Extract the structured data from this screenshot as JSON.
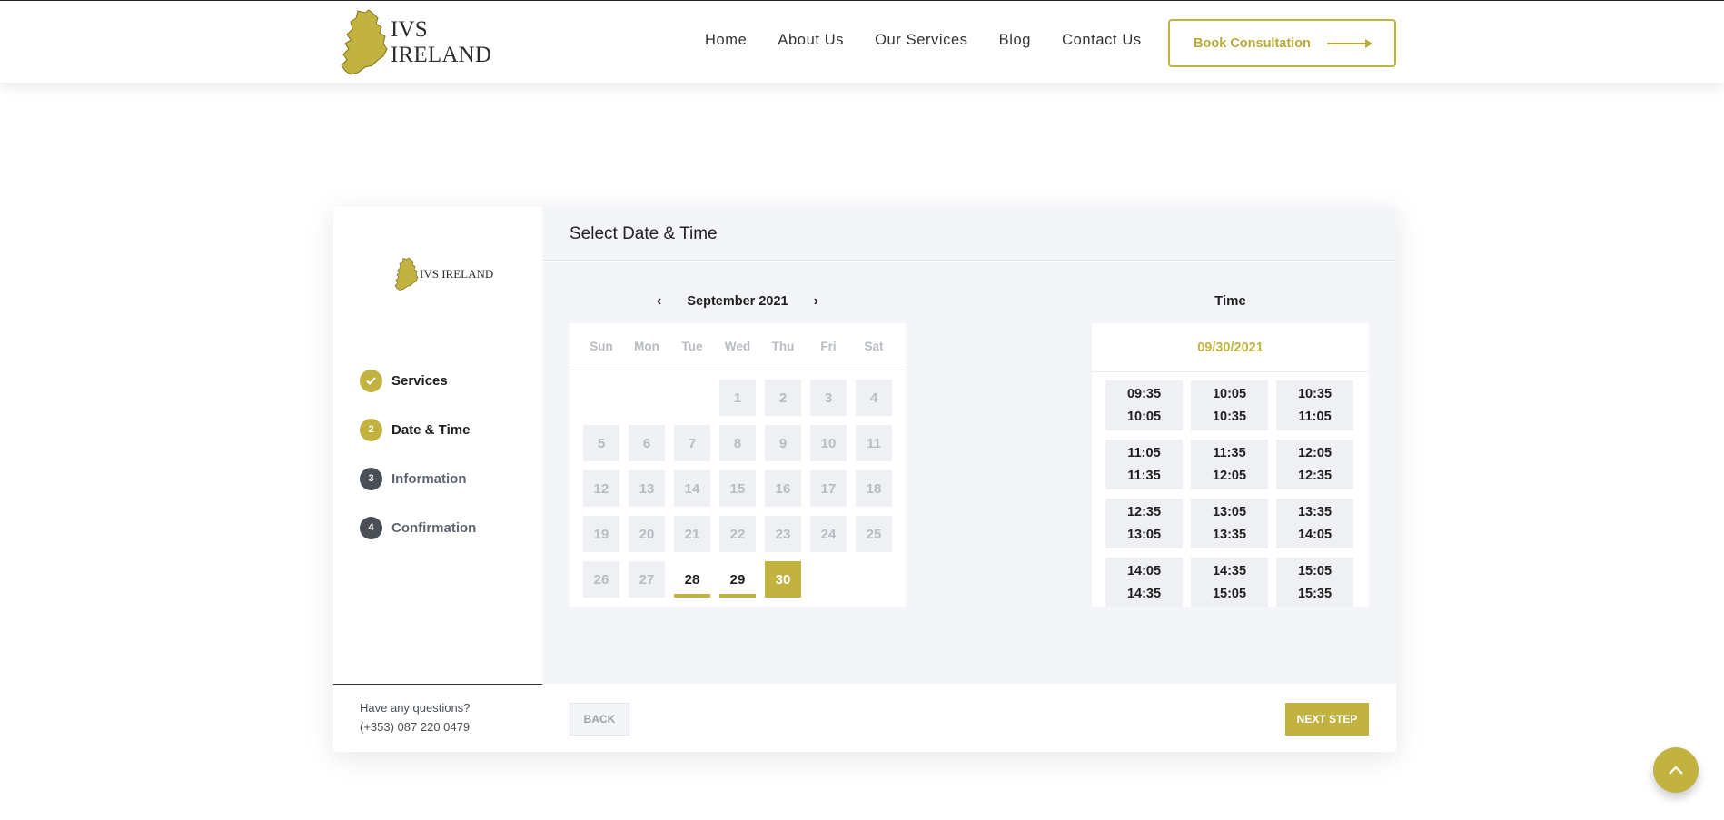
{
  "header": {
    "brand": "IVS IRELAND",
    "nav": [
      "Home",
      "About Us",
      "Our Services",
      "Blog",
      "Contact Us"
    ],
    "cta_label": "Book Consultation"
  },
  "booking": {
    "sidebar": {
      "brand": "IVS IRELAND",
      "steps": [
        {
          "number": "",
          "label": "Services",
          "status": "done"
        },
        {
          "number": "2",
          "label": "Date & Time",
          "status": "active"
        },
        {
          "number": "3",
          "label": "Information",
          "status": "pending"
        },
        {
          "number": "4",
          "label": "Confirmation",
          "status": "pending"
        }
      ],
      "questions_label": "Have any questions?",
      "phone": "(+353) 087 220 0479"
    },
    "title": "Select Date & Time",
    "calendar": {
      "month": "September 2021",
      "weekdays": [
        "Sun",
        "Mon",
        "Tue",
        "Wed",
        "Thu",
        "Fri",
        "Sat"
      ],
      "leading_blanks": 3,
      "days": [
        "1",
        "2",
        "3",
        "4",
        "5",
        "6",
        "7",
        "8",
        "9",
        "10",
        "11",
        "12",
        "13",
        "14",
        "15",
        "16",
        "17",
        "18",
        "19",
        "20",
        "21",
        "22",
        "23",
        "24",
        "25",
        "26",
        "27",
        "28",
        "29",
        "30"
      ],
      "available_days": [
        "28",
        "29"
      ],
      "selected_day": "30"
    },
    "time": {
      "title": "Time",
      "selected_date": "09/30/2021",
      "slots": [
        {
          "start": "09:35",
          "end": "10:05"
        },
        {
          "start": "10:05",
          "end": "10:35"
        },
        {
          "start": "10:35",
          "end": "11:05"
        },
        {
          "start": "11:05",
          "end": "11:35"
        },
        {
          "start": "11:35",
          "end": "12:05"
        },
        {
          "start": "12:05",
          "end": "12:35"
        },
        {
          "start": "12:35",
          "end": "13:05"
        },
        {
          "start": "13:05",
          "end": "13:35"
        },
        {
          "start": "13:35",
          "end": "14:05"
        },
        {
          "start": "14:05",
          "end": "14:35"
        },
        {
          "start": "14:35",
          "end": "15:05"
        },
        {
          "start": "15:05",
          "end": "15:35"
        }
      ]
    },
    "back_label": "BACK",
    "next_label": "NEXT STEP"
  },
  "colors": {
    "accent": "#c2b340",
    "panel_bg": "#f3f5f8",
    "step_pending": "#4a4f57"
  },
  "icons": {
    "logo": "ireland-map-icon",
    "prev": "chevron-left-icon",
    "next": "chevron-right-icon",
    "done_step": "check-icon",
    "scroll_top": "chevron-up-icon"
  }
}
